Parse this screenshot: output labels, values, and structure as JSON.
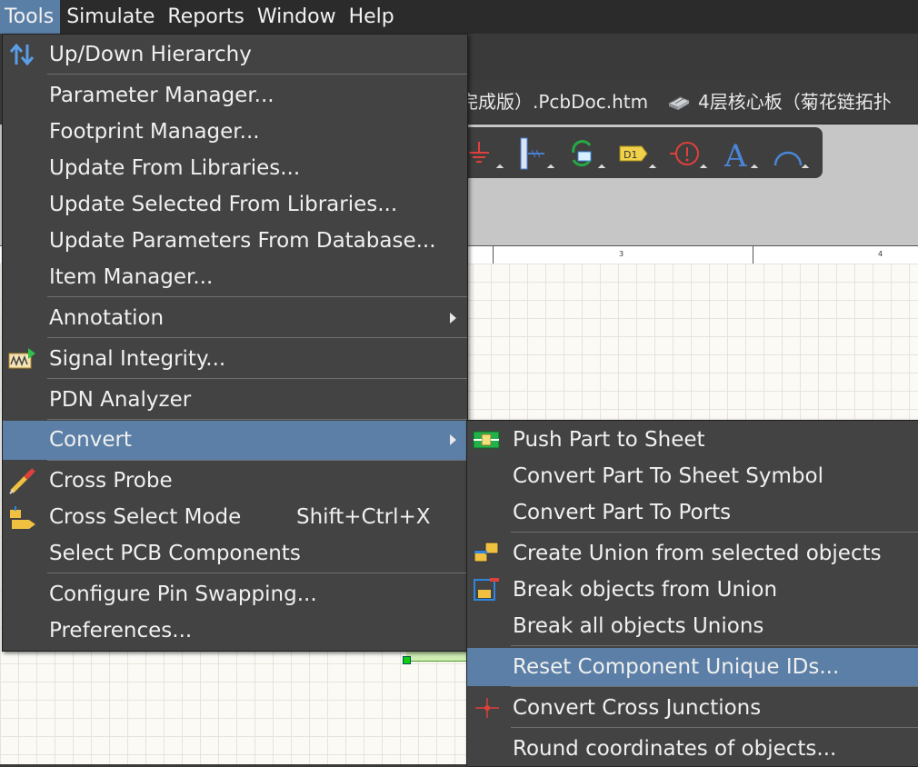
{
  "menubar": {
    "items": [
      "Tools",
      "Simulate",
      "Reports",
      "Window",
      "Help"
    ]
  },
  "doc_tabs": {
    "tab1": "已完成版）.PcbDoc.htm",
    "tab2": "4层核心板（菊花链拓扑"
  },
  "ruler": {
    "label3": "3",
    "label4": "4"
  },
  "tools_menu": {
    "items": [
      {
        "label": "Up/Down Hierarchy",
        "icon": "up-down-hierarchy-icon"
      },
      {
        "label": "Parameter Manager..."
      },
      {
        "label": "Footprint Manager..."
      },
      {
        "label": "Update From Libraries..."
      },
      {
        "label": "Update Selected From Libraries..."
      },
      {
        "label": "Update Parameters From Database..."
      },
      {
        "label": "Item Manager..."
      },
      {
        "label": "Annotation",
        "submenu": true
      },
      {
        "label": "Signal Integrity...",
        "icon": "signal-integrity-icon"
      },
      {
        "label": "PDN Analyzer"
      },
      {
        "label": "Convert",
        "submenu": true,
        "highlighted": true
      },
      {
        "label": "Cross Probe",
        "icon": "cross-probe-icon"
      },
      {
        "label": "Cross Select Mode",
        "shortcut": "Shift+Ctrl+X",
        "icon": "cross-select-icon"
      },
      {
        "label": "Select PCB Components"
      },
      {
        "label": "Configure Pin Swapping..."
      },
      {
        "label": "Preferences..."
      }
    ]
  },
  "convert_menu": {
    "items": [
      {
        "label": "Push Part to Sheet",
        "icon": "push-part-icon"
      },
      {
        "label": "Convert Part To Sheet Symbol"
      },
      {
        "label": "Convert Part To Ports"
      },
      {
        "label": "Create Union from selected objects",
        "icon": "create-union-icon"
      },
      {
        "label": "Break objects from Union",
        "icon": "break-union-icon"
      },
      {
        "label": "Break all objects Unions"
      },
      {
        "label": "Reset Component Unique IDs...",
        "highlighted": true
      },
      {
        "label": "Convert Cross Junctions",
        "icon": "cross-junction-icon"
      },
      {
        "label": "Round coordinates of objects..."
      }
    ]
  },
  "colors": {
    "menu_bg": "#434343",
    "highlight": "#5b7fa6",
    "menubar_bg": "#2b2b2b"
  }
}
